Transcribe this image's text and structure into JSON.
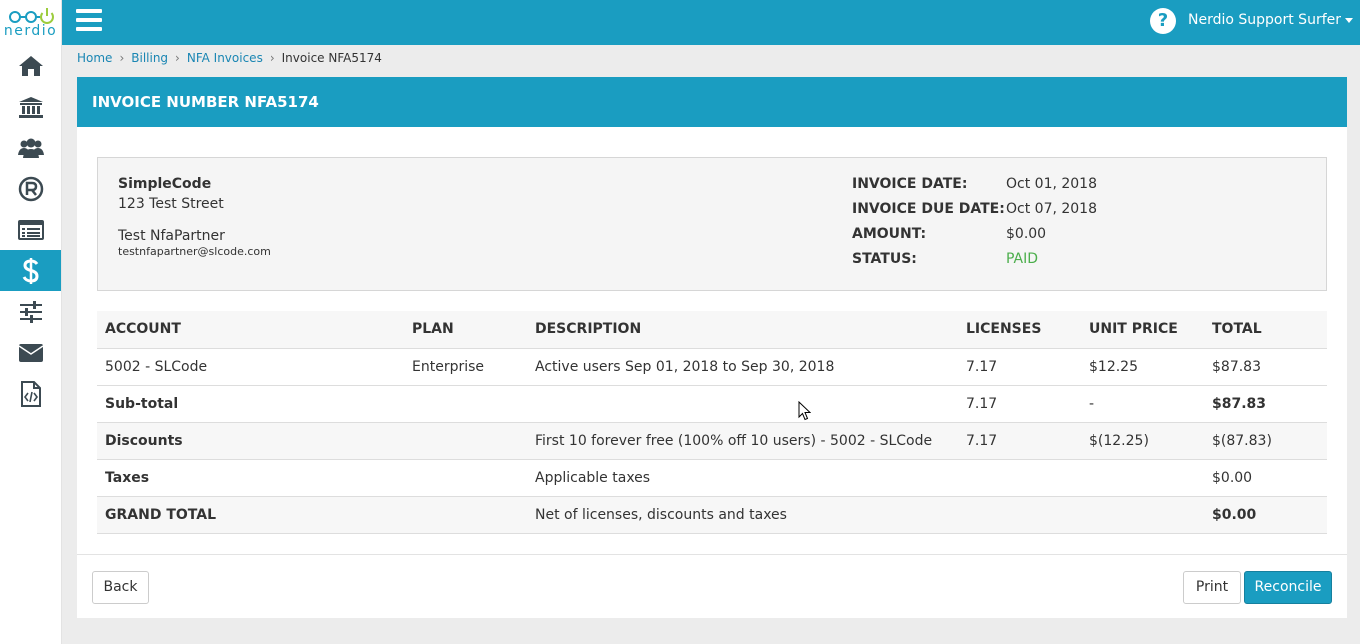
{
  "brand": {
    "logo_text": "nerdio",
    "accent": "#1a9dc1",
    "paid_color": "#4cae4c"
  },
  "sidebar": {
    "items": [
      {
        "icon": "home-icon"
      },
      {
        "icon": "bank-icon"
      },
      {
        "icon": "users-icon"
      },
      {
        "icon": "registered-icon"
      },
      {
        "icon": "list-icon"
      },
      {
        "icon": "dollar-icon",
        "active": true
      },
      {
        "icon": "sliders-icon"
      },
      {
        "icon": "envelope-icon"
      },
      {
        "icon": "code-file-icon"
      }
    ]
  },
  "header": {
    "user_name": "Nerdio Support Surfer",
    "help_glyph": "?"
  },
  "breadcrumb": [
    "Home",
    "Billing",
    "NFA Invoices",
    "Invoice NFA5174"
  ],
  "invoice": {
    "title": "INVOICE NUMBER NFA5174",
    "company": "SimpleCode",
    "street": "123 Test Street",
    "contact_name": "Test NfaPartner",
    "contact_email": "testnfapartner@slcode.com",
    "meta": [
      {
        "label": "INVOICE DATE:",
        "value": "Oct 01, 2018"
      },
      {
        "label": "INVOICE DUE DATE:",
        "value": "Oct 07, 2018"
      },
      {
        "label": "AMOUNT:",
        "value": "$0.00"
      },
      {
        "label": "STATUS:",
        "value": "PAID"
      }
    ]
  },
  "table": {
    "columns": [
      "ACCOUNT",
      "PLAN",
      "DESCRIPTION",
      "LICENSES",
      "UNIT PRICE",
      "TOTAL"
    ],
    "rows": [
      {
        "account": "5002 - SLCode",
        "plan": "Enterprise",
        "description": "Active users Sep 01, 2018 to Sep 30, 2018",
        "licenses": "7.17",
        "unit_price": "$12.25",
        "total": "$87.83"
      },
      {
        "account": "Sub-total",
        "plan": "",
        "description": "",
        "licenses": "7.17",
        "unit_price": "-",
        "total": "$87.83"
      },
      {
        "account": "Discounts",
        "plan": "",
        "description": "First 10 forever free (100% off 10 users) - 5002 - SLCode",
        "licenses": "7.17",
        "unit_price": "$(12.25)",
        "total": "$(87.83)"
      },
      {
        "account": "Taxes",
        "plan": "",
        "description": "Applicable taxes",
        "licenses": "",
        "unit_price": "",
        "total": "$0.00"
      },
      {
        "account": "GRAND TOTAL",
        "plan": "",
        "description": "Net of licenses, discounts and taxes",
        "licenses": "",
        "unit_price": "",
        "total": "$0.00"
      }
    ]
  },
  "actions": {
    "back": "Back",
    "print": "Print",
    "reconcile": "Reconcile"
  }
}
